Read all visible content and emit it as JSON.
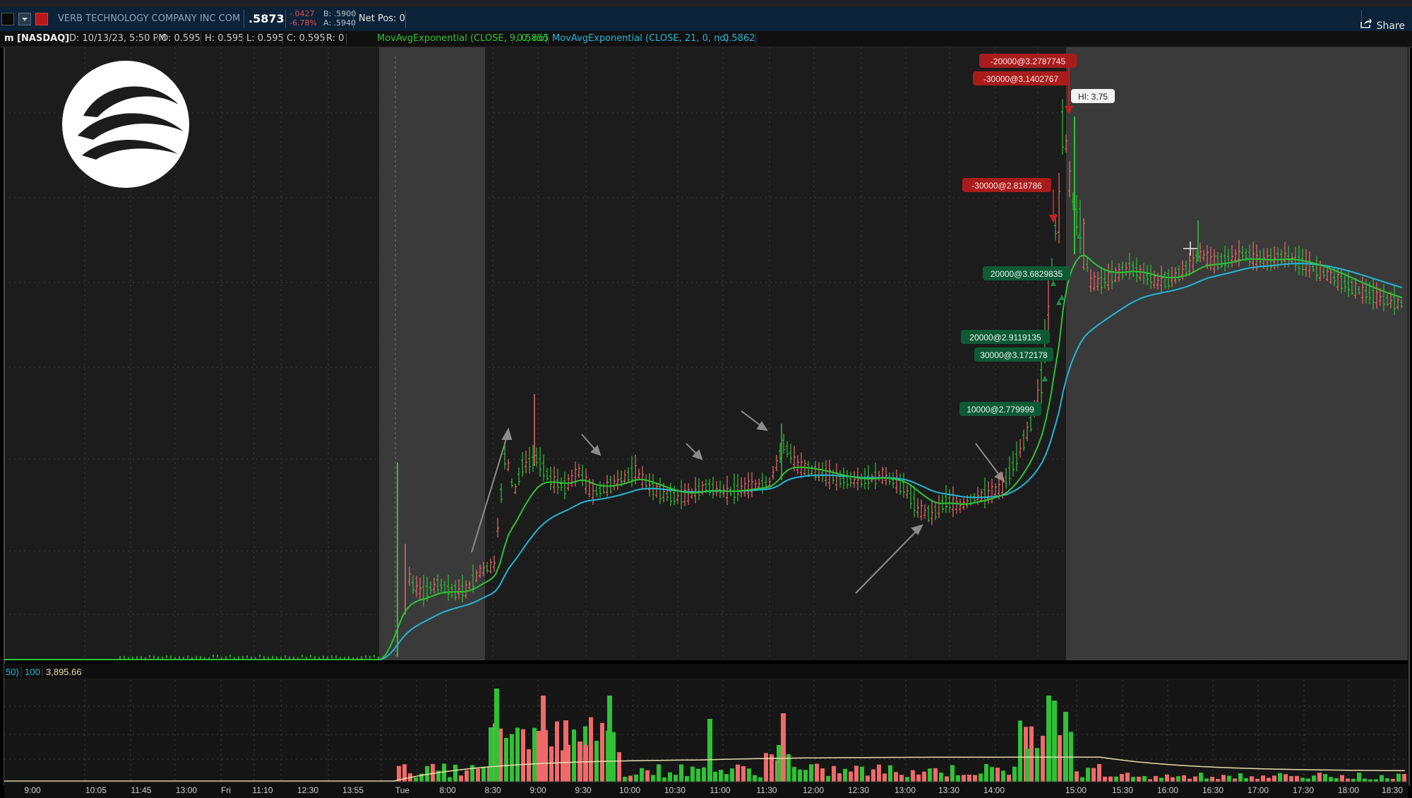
{
  "header": {
    "company_name": "VERB TECHNOLOGY COMPANY INC COM",
    "last_price": ".5873",
    "change": "-.0427",
    "change_pct": "-6.78%",
    "bid": "B: .5900",
    "ask": "A: .5940",
    "net_pos": "Net Pos: 0",
    "share_label": "Share"
  },
  "study_bar": {
    "symbol": "m [NASDAQ]",
    "date": "D: 10/13/23, 5:50 PM",
    "open": "O: 0.595",
    "high": "H: 0.595",
    "low": "L: 0.595",
    "close": "C: 0.595",
    "range": "R: 0",
    "ema9_label": "MovAvgExponential (CLOSE, 9, 0, no)",
    "ema9_value": "0.5855",
    "ema21_label": "MovAvgExponential (CLOSE, 21, 0, no)",
    "ema21_value": "0.5862"
  },
  "volume_bar": {
    "avg_label": "50)",
    "length": "100",
    "value": "3,895.66"
  },
  "hi_label": "HI: 3.75",
  "orders": [
    {
      "text": "-20000@3.2787745",
      "side": "sell"
    },
    {
      "text": "-30000@3.1402767",
      "side": "sell"
    },
    {
      "text": "-30000@2.818786",
      "side": "sell"
    },
    {
      "text": "20000@3.6829835",
      "side": "buy"
    },
    {
      "text": "20000@2.9119135",
      "side": "buy"
    },
    {
      "text": "30000@3.172178",
      "side": "buy"
    },
    {
      "text": "10000@2.779999",
      "side": "buy"
    }
  ],
  "time_axis": [
    "9:00",
    "10:05",
    "11:45",
    "13:00",
    "Fri",
    "11:10",
    "12:30",
    "13:55",
    "Tue",
    "8:00",
    "8:30",
    "9:00",
    "9:30",
    "10:00",
    "10:30",
    "11:00",
    "11:30",
    "12:00",
    "12:30",
    "13:00",
    "13:30",
    "14:00",
    "15:00",
    "15:30",
    "16:00",
    "16:30",
    "17:00",
    "17:30",
    "18:00",
    "18:30"
  ],
  "colors": {
    "up": "#2fc236",
    "down": "#f06a6a",
    "ema9": "#2fc236",
    "ema21": "#23b6d6",
    "volume_avg": "#e8dcb0",
    "sell_bubble": "#a81c1c",
    "buy_bubble": "#0f5a36",
    "extended_hours": "#3a3a3a",
    "header_bg": "#0c2238"
  },
  "icons": [
    "symbol-color-square-icon",
    "dropdown-arrow-icon",
    "link-red-square-icon",
    "share-icon",
    "company-logo-icon",
    "order-sell-arrow-icon",
    "order-buy-arrow-icon"
  ]
}
